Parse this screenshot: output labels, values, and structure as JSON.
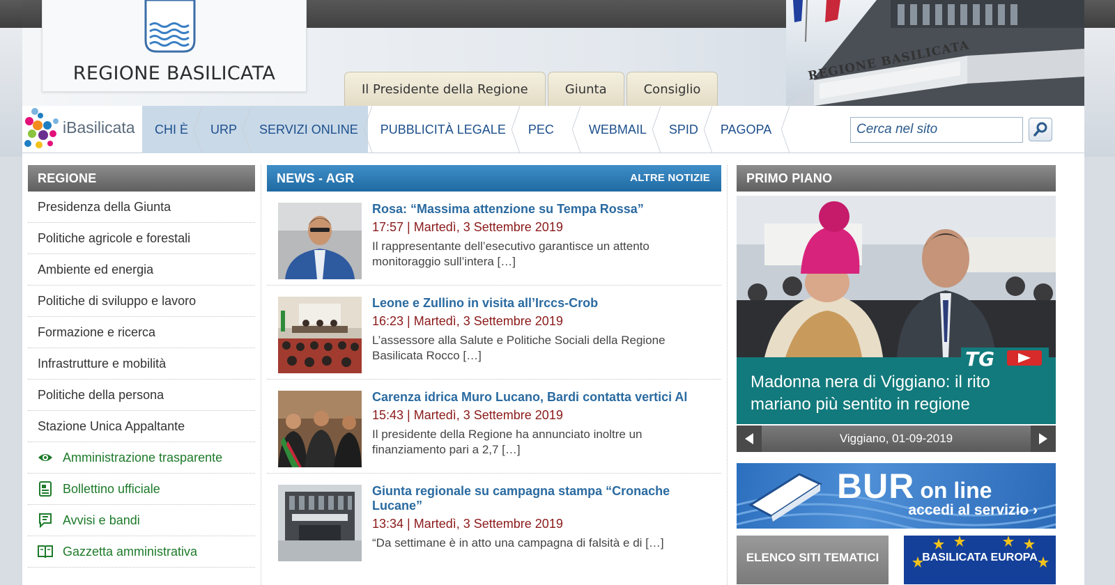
{
  "header": {
    "logo_text": "REGIONE BASILICATA",
    "building_sign": "REGIONE BASILICATA",
    "top_tabs": [
      "Il Presidente della Regione",
      "Giunta",
      "Consiglio"
    ]
  },
  "nav": {
    "brand": "iBasilicata",
    "items": [
      {
        "label": "CHI È",
        "active": true
      },
      {
        "label": "URP",
        "active": true
      },
      {
        "label": "SERVIZI ONLINE",
        "active": true
      },
      {
        "label": "PUBBLICITÀ LEGALE",
        "active": false
      },
      {
        "label": "PEC",
        "active": false
      },
      {
        "label": "WEBMAIL",
        "active": false
      },
      {
        "label": "SPID",
        "active": false
      },
      {
        "label": "PAGOPA",
        "active": false
      }
    ],
    "search_placeholder": "Cerca nel sito",
    "search_icon": "magnifier-icon"
  },
  "regione": {
    "title": "REGIONE",
    "items": [
      "Presidenza della Giunta",
      "Politiche agricole e forestali",
      "Ambiente ed energia",
      "Politiche di sviluppo e lavoro",
      "Formazione e ricerca",
      "Infrastrutture e mobilità",
      "Politiche della persona",
      "Stazione Unica Appaltante"
    ],
    "green_items": [
      {
        "label": "Amministrazione trasparente",
        "icon": "eye-icon"
      },
      {
        "label": "Bollettino ufficiale",
        "icon": "newspaper-icon"
      },
      {
        "label": "Avvisi e bandi",
        "icon": "notice-icon"
      },
      {
        "label": "Gazzetta amministrativa",
        "icon": "book-icon"
      }
    ]
  },
  "news": {
    "title": "NEWS - AGR",
    "more": "ALTRE NOTIZIE",
    "items": [
      {
        "title": "Rosa: “Massima attenzione su Tempa Rossa”",
        "time": "17:57 | Martedì, 3 Settembre 2019",
        "excerpt": "Il rappresentante dell’esecutivo garantisce un attento monitoraggio sull’intera […]"
      },
      {
        "title": "Leone e Zullino in visita all’Irccs-Crob",
        "time": "16:23 | Martedì, 3 Settembre 2019",
        "excerpt": "L’assessore alla Salute e Politiche Sociali della Regione Basilicata Rocco […]"
      },
      {
        "title": "Carenza idrica Muro Lucano, Bardi contatta vertici Al",
        "time": "15:43 | Martedì, 3 Settembre 2019",
        "excerpt": "Il presidente della Regione ha annunciato inoltre un finanziamento pari a 2,7 […]"
      },
      {
        "title": "Giunta regionale su campagna stampa “Cronache Lucane”",
        "time": "13:34 | Martedì, 3 Settembre 2019",
        "excerpt": "“Da settimane è in atto una campagna di falsità e di […]"
      }
    ]
  },
  "primo_piano": {
    "title": "PRIMO PIANO",
    "tg_logo": "TG",
    "caption": "Madonna nera di Viggiano: il rito mariano più sentito in regione",
    "place_date": "Viggiano, 01-09-2019",
    "prev_icon": "chevron-left-icon",
    "next_icon": "chevron-right-icon"
  },
  "bur": {
    "title": "BUR",
    "suffix": "on line",
    "sub": "accedi al servizio ›"
  },
  "links": {
    "elenco": "ELENCO SITI TEMATICI",
    "europa": "BASILICATA EUROPA"
  },
  "colors": {
    "nav_blue": "#1d4f8c",
    "news_title": "#2a6aa0",
    "news_time": "#8b1a1a",
    "green": "#1d7a2a",
    "caption_bg": "#127a7c",
    "bur_bg": "#2c6fbe"
  }
}
